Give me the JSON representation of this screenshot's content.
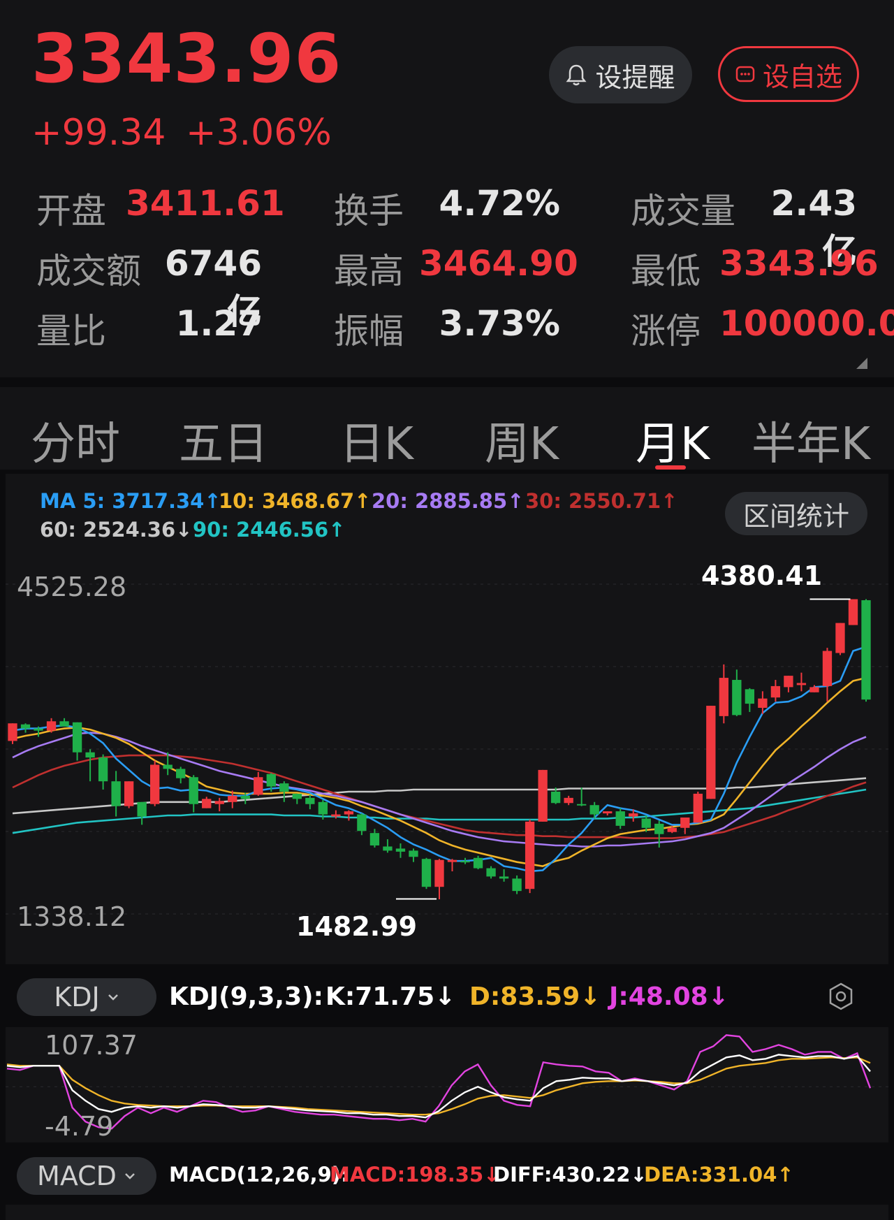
{
  "header": {
    "price": "3343.96",
    "change": "+99.34",
    "change_pct": "+3.06%",
    "remind_label": "设提醒",
    "watch_label": "设自选",
    "stats": {
      "open_label": "开盘",
      "open": "3411.61",
      "turnover_label": "换手",
      "turnover": "4.72%",
      "volume_label": "成交量",
      "volume": "2.43亿",
      "amount_label": "成交额",
      "amount": "6746亿",
      "high_label": "最高",
      "high": "3464.90",
      "low_label": "最低",
      "low": "3343.96",
      "vol_ratio_label": "量比",
      "vol_ratio": "1.27",
      "amplitude_label": "振幅",
      "amplitude": "3.73%",
      "limit_up_label": "涨停",
      "limit_up": "100000.0"
    }
  },
  "tabs": [
    {
      "label": "分时"
    },
    {
      "label": "五日"
    },
    {
      "label": "日K"
    },
    {
      "label": "周K"
    },
    {
      "label": "月K",
      "active": true
    },
    {
      "label": "半年K"
    }
  ],
  "ma": {
    "ma5": "MA 5: 3717.34↑",
    "ma10": "10: 3468.67↑",
    "ma20": "20: 2885.85↑",
    "ma30": "30: 2550.71↑",
    "ma60": "60: 2524.36↓",
    "ma90": "90: 2446.56↑"
  },
  "range_stats_label": "区间统计",
  "colors": {
    "up": "#f0383f",
    "down": "#1fb04a",
    "ma5": "#2a9df4",
    "ma10": "#f0b429",
    "ma20": "#a77bf3",
    "ma30": "#c0302f",
    "ma60": "#c8c8c8",
    "ma90": "#22c4c4"
  },
  "chart_data": [
    {
      "type": "candlestick",
      "title": "月K",
      "y_axis_top": "4525.28",
      "y_axis_bottom": "1338.12",
      "ylim": [
        1338.12,
        4525.28
      ],
      "max_label": "4380.41",
      "min_label": "1482.99",
      "candles": [
        [
          3010,
          3180,
          2980,
          3180
        ],
        [
          3170,
          3180,
          3090,
          3130
        ],
        [
          3130,
          3150,
          3050,
          3110
        ],
        [
          3110,
          3230,
          3090,
          3200
        ],
        [
          3200,
          3230,
          3150,
          3150
        ],
        [
          3190,
          3190,
          2820,
          2900
        ],
        [
          2900,
          2930,
          2620,
          2850
        ],
        [
          2850,
          2880,
          2540,
          2620
        ],
        [
          2620,
          2720,
          2280,
          2380
        ],
        [
          2380,
          2620,
          2360,
          2620
        ],
        [
          2420,
          2420,
          2200,
          2280
        ],
        [
          2400,
          2820,
          2380,
          2780
        ],
        [
          2780,
          2900,
          2680,
          2740
        ],
        [
          2740,
          2760,
          2600,
          2650
        ],
        [
          2660,
          2680,
          2320,
          2400
        ],
        [
          2360,
          2470,
          2360,
          2450
        ],
        [
          2400,
          2460,
          2330,
          2430
        ],
        [
          2420,
          2530,
          2360,
          2480
        ],
        [
          2480,
          2510,
          2400,
          2450
        ],
        [
          2490,
          2710,
          2480,
          2660
        ],
        [
          2690,
          2700,
          2520,
          2570
        ],
        [
          2600,
          2620,
          2420,
          2520
        ],
        [
          2500,
          2500,
          2400,
          2450
        ],
        [
          2460,
          2490,
          2350,
          2400
        ],
        [
          2420,
          2440,
          2250,
          2300
        ],
        [
          2280,
          2340,
          2260,
          2300
        ],
        [
          2300,
          2340,
          2240,
          2330
        ],
        [
          2300,
          2310,
          2100,
          2140
        ],
        [
          2120,
          2160,
          1980,
          2000
        ],
        [
          1990,
          2060,
          1930,
          1950
        ],
        [
          1970,
          2020,
          1880,
          1940
        ],
        [
          1950,
          1970,
          1840,
          1890
        ],
        [
          1870,
          1880,
          1580,
          1600
        ],
        [
          1600,
          1870,
          1480,
          1860
        ],
        [
          1840,
          1870,
          1750,
          1860
        ],
        [
          1850,
          1880,
          1820,
          1840
        ],
        [
          1880,
          1900,
          1770,
          1780
        ],
        [
          1780,
          1800,
          1680,
          1700
        ],
        [
          1700,
          1770,
          1650,
          1680
        ],
        [
          1680,
          1710,
          1530,
          1560
        ],
        [
          1580,
          2250,
          1540,
          2230
        ],
        [
          2230,
          2730,
          2230,
          2730
        ],
        [
          2520,
          2560,
          2400,
          2410
        ],
        [
          2410,
          2480,
          2390,
          2460
        ],
        [
          2400,
          2560,
          2380,
          2390
        ],
        [
          2390,
          2420,
          2260,
          2300
        ],
        [
          2310,
          2330,
          2290,
          2330
        ],
        [
          2330,
          2360,
          2160,
          2190
        ],
        [
          2280,
          2350,
          2230,
          2310
        ],
        [
          2260,
          2290,
          2130,
          2170
        ],
        [
          2210,
          2240,
          1980,
          2110
        ],
        [
          2130,
          2190,
          2120,
          2170
        ],
        [
          2170,
          2270,
          2110,
          2270
        ],
        [
          2220,
          2520,
          2220,
          2500
        ],
        [
          2450,
          3350,
          2450,
          3350
        ],
        [
          3250,
          3750,
          3180,
          3620
        ],
        [
          3600,
          3700,
          3250,
          3260
        ],
        [
          3510,
          3520,
          3290,
          3370
        ],
        [
          3330,
          3490,
          3270,
          3420
        ],
        [
          3430,
          3600,
          3390,
          3540
        ],
        [
          3530,
          3640,
          3480,
          3640
        ],
        [
          3550,
          3670,
          3490,
          3570
        ],
        [
          3480,
          3550,
          3480,
          3530
        ],
        [
          3540,
          3910,
          3390,
          3880
        ],
        [
          3860,
          4150,
          3840,
          4150
        ],
        [
          4130,
          4380,
          4130,
          4380
        ],
        [
          4370,
          4380,
          3390,
          3410
        ]
      ],
      "ma_lines": {
        "ma5": [
          3110,
          3130,
          3130,
          3150,
          3160,
          3140,
          3080,
          2990,
          2840,
          2730,
          2620,
          2550,
          2560,
          2530,
          2540,
          2530,
          2490,
          2480,
          2480,
          2530,
          2550,
          2560,
          2540,
          2510,
          2450,
          2390,
          2360,
          2310,
          2240,
          2170,
          2080,
          2010,
          1960,
          1900,
          1850,
          1850,
          1860,
          1880,
          1800,
          1780,
          1750,
          1760,
          1870,
          2010,
          2120,
          2270,
          2390,
          2360,
          2340,
          2300,
          2250,
          2200,
          2200,
          2220,
          2250,
          2500,
          2800,
          3050,
          3280,
          3380,
          3390,
          3440,
          3530,
          3540,
          3590,
          3880,
          3920
        ],
        "ma10": [
          3030,
          3060,
          3080,
          3110,
          3130,
          3140,
          3120,
          3080,
          3040,
          2980,
          2900,
          2820,
          2760,
          2700,
          2640,
          2570,
          2540,
          2510,
          2500,
          2500,
          2500,
          2510,
          2510,
          2490,
          2480,
          2460,
          2430,
          2380,
          2340,
          2290,
          2240,
          2180,
          2120,
          2050,
          2000,
          1960,
          1930,
          1900,
          1870,
          1840,
          1820,
          1800,
          1850,
          1880,
          1950,
          2010,
          2070,
          2110,
          2130,
          2150,
          2160,
          2180,
          2200,
          2210,
          2240,
          2300,
          2450,
          2610,
          2770,
          2920,
          3030,
          3150,
          3260,
          3380,
          3490,
          3590,
          3620
        ],
        "ma20": [
          2850,
          2910,
          2960,
          3000,
          3040,
          3080,
          3090,
          3080,
          3050,
          3010,
          2960,
          2920,
          2880,
          2840,
          2800,
          2760,
          2720,
          2690,
          2660,
          2630,
          2600,
          2570,
          2550,
          2530,
          2500,
          2480,
          2450,
          2420,
          2380,
          2340,
          2300,
          2260,
          2220,
          2180,
          2140,
          2110,
          2080,
          2060,
          2040,
          2030,
          2020,
          2010,
          2000,
          2000,
          1990,
          1990,
          2000,
          2000,
          2010,
          2020,
          2030,
          2040,
          2060,
          2090,
          2120,
          2170,
          2250,
          2330,
          2420,
          2510,
          2600,
          2680,
          2760,
          2850,
          2930,
          3000,
          3050
        ],
        "ma30": [
          2560,
          2620,
          2680,
          2730,
          2770,
          2800,
          2830,
          2850,
          2860,
          2870,
          2870,
          2870,
          2870,
          2860,
          2850,
          2830,
          2810,
          2790,
          2760,
          2730,
          2700,
          2660,
          2620,
          2580,
          2540,
          2500,
          2460,
          2420,
          2380,
          2340,
          2300,
          2270,
          2240,
          2210,
          2180,
          2150,
          2130,
          2120,
          2110,
          2100,
          2100,
          2090,
          2090,
          2080,
          2080,
          2080,
          2080,
          2080,
          2070,
          2070,
          2070,
          2070,
          2080,
          2090,
          2110,
          2130,
          2170,
          2210,
          2250,
          2290,
          2340,
          2380,
          2430,
          2480,
          2520,
          2570,
          2610
        ],
        "ma60": [
          2310,
          2320,
          2330,
          2340,
          2350,
          2360,
          2370,
          2380,
          2390,
          2400,
          2410,
          2420,
          2420,
          2420,
          2420,
          2420,
          2420,
          2430,
          2440,
          2450,
          2460,
          2470,
          2480,
          2490,
          2500,
          2510,
          2520,
          2520,
          2520,
          2530,
          2530,
          2540,
          2540,
          2540,
          2540,
          2540,
          2540,
          2540,
          2540,
          2540,
          2540,
          2540,
          2540,
          2550,
          2550,
          2550,
          2550,
          2550,
          2550,
          2550,
          2550,
          2550,
          2550,
          2550,
          2550,
          2550,
          2560,
          2560,
          2570,
          2580,
          2590,
          2600,
          2610,
          2620,
          2630,
          2640,
          2650
        ],
        "ma90": [
          2120,
          2140,
          2160,
          2180,
          2200,
          2220,
          2230,
          2240,
          2250,
          2260,
          2270,
          2280,
          2290,
          2290,
          2300,
          2300,
          2300,
          2300,
          2300,
          2300,
          2300,
          2290,
          2290,
          2290,
          2280,
          2280,
          2270,
          2270,
          2270,
          2260,
          2260,
          2260,
          2260,
          2250,
          2250,
          2250,
          2250,
          2250,
          2250,
          2250,
          2250,
          2250,
          2250,
          2250,
          2260,
          2260,
          2260,
          2270,
          2270,
          2280,
          2290,
          2300,
          2310,
          2320,
          2330,
          2340,
          2350,
          2360,
          2380,
          2400,
          2420,
          2440,
          2460,
          2480,
          2500,
          2520,
          2540
        ]
      }
    },
    {
      "type": "line",
      "title": "KDJ",
      "params": "KDJ(9,3,3):",
      "k_label": "K:71.75↓",
      "d_label": "D:83.59↓",
      "j_label": "J:48.08↓",
      "y_axis_top": "107.37",
      "y_axis_bottom": "-4.79",
      "ylim": [
        -4.79,
        107.37
      ],
      "series": [
        {
          "name": "K",
          "color": "#ffffff",
          "values": [
            80,
            78,
            80,
            80,
            80,
            45,
            30,
            18,
            14,
            20,
            22,
            20,
            22,
            20,
            22,
            25,
            24,
            22,
            20,
            20,
            22,
            20,
            18,
            16,
            15,
            14,
            12,
            12,
            10,
            10,
            8,
            8,
            6,
            15,
            30,
            42,
            50,
            42,
            35,
            32,
            30,
            48,
            58,
            60,
            63,
            62,
            62,
            58,
            60,
            58,
            55,
            52,
            56,
            72,
            82,
            92,
            95,
            88,
            90,
            96,
            94,
            92,
            94,
            94,
            90,
            94,
            72
          ]
        },
        {
          "name": "D",
          "color": "#f0b429",
          "values": [
            82,
            80,
            80,
            80,
            80,
            60,
            48,
            38,
            30,
            26,
            24,
            23,
            22,
            22,
            22,
            23,
            23,
            22,
            22,
            22,
            22,
            21,
            20,
            18,
            17,
            16,
            15,
            14,
            13,
            12,
            11,
            10,
            10,
            12,
            18,
            25,
            33,
            37,
            38,
            36,
            34,
            38,
            45,
            50,
            55,
            57,
            58,
            58,
            59,
            58,
            57,
            55,
            55,
            60,
            68,
            76,
            80,
            82,
            84,
            88,
            90,
            90,
            91,
            92,
            91,
            92,
            84
          ]
        },
        {
          "name": "J",
          "color": "#e244e0",
          "values": [
            76,
            74,
            80,
            80,
            80,
            20,
            0,
            -8,
            -10,
            8,
            20,
            12,
            20,
            14,
            22,
            30,
            28,
            20,
            14,
            16,
            22,
            18,
            14,
            12,
            10,
            10,
            8,
            6,
            4,
            4,
            2,
            4,
            0,
            22,
            52,
            72,
            82,
            52,
            30,
            24,
            22,
            85,
            82,
            80,
            79,
            72,
            70,
            58,
            62,
            58,
            52,
            46,
            58,
            100,
            108,
            124,
            122,
            100,
            104,
            110,
            104,
            96,
            100,
            100,
            90,
            98,
            48
          ]
        }
      ]
    }
  ],
  "kdj": {
    "selector_label": "KDJ",
    "params": "KDJ(9,3,3):",
    "k": "K:71.75↓",
    "d": "D:83.59↓",
    "j": "J:48.08↓",
    "y_top": "107.37",
    "y_bottom": "-4.79"
  },
  "macd": {
    "selector_label": "MACD",
    "params": "MACD(12,26,9):",
    "macd": "MACD:198.35↓",
    "diff": "DIFF:430.22↓",
    "dea": "DEA:331.04↑"
  }
}
